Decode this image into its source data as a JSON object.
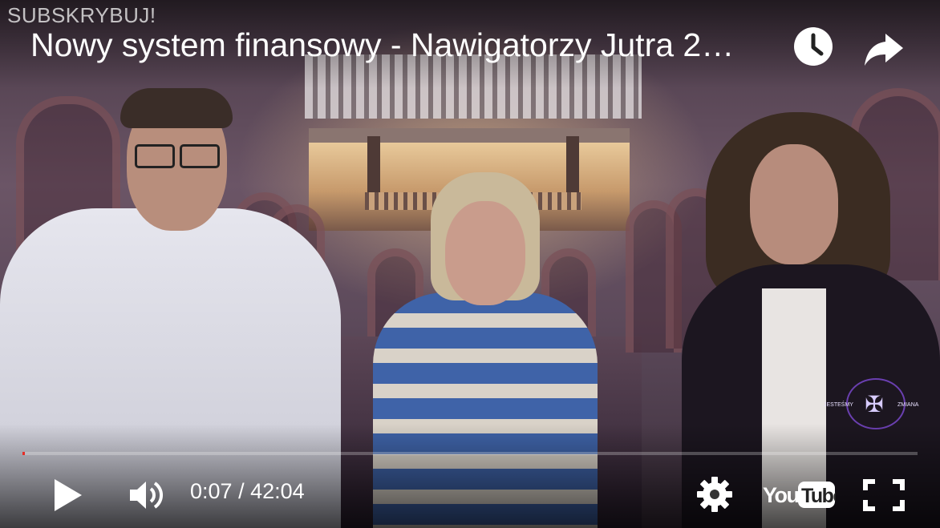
{
  "overlay": {
    "subscribe_label": "SUBSKRYBUJ!",
    "title": "Nowy system finansowy - Nawigatorzy Jutra 2…"
  },
  "icons": {
    "watch_later": "clock-icon",
    "share": "share-arrow-icon",
    "play": "play-icon",
    "volume": "volume-icon",
    "settings": "gear-icon",
    "youtube": "youtube-logo",
    "fullscreen": "fullscreen-icon"
  },
  "controls": {
    "current_time": "0:07",
    "separator": " / ",
    "duration": "42:04",
    "youtube_label": "YouTube",
    "progress_fraction": 0.003
  },
  "colors": {
    "progress": "#e52d27",
    "text": "#ffffff"
  }
}
